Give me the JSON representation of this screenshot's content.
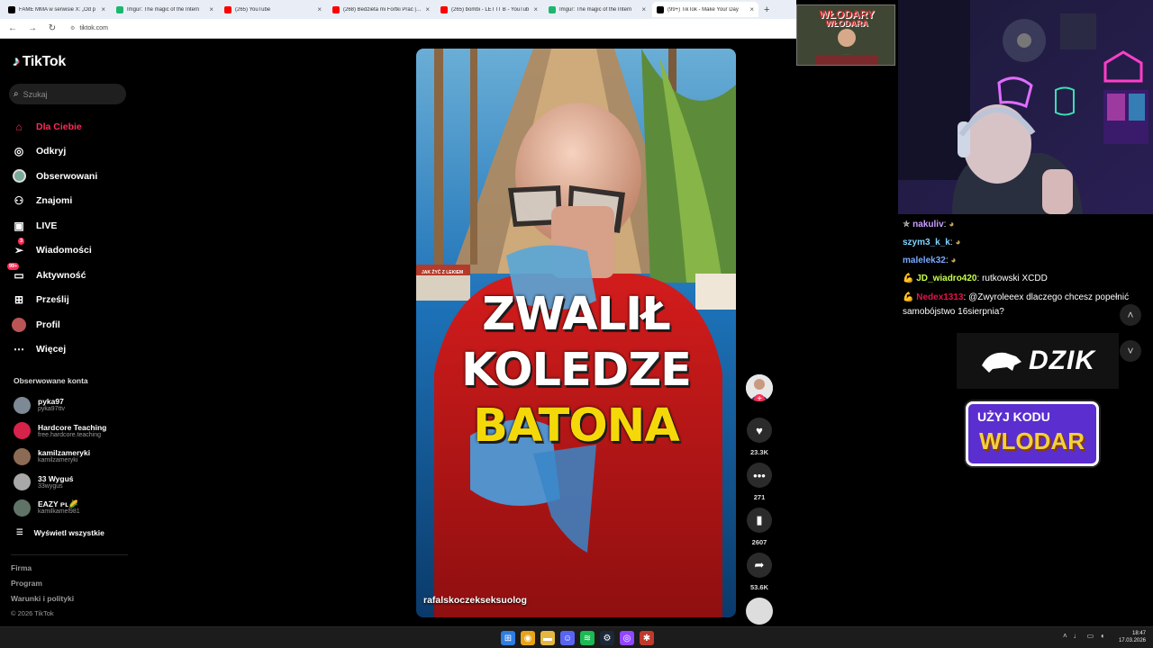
{
  "browser": {
    "tabs": [
      {
        "title": "FAME MMA w serwisie X: „Od p",
        "icon_color": "#000000",
        "active": false
      },
      {
        "title": "Imgur: The magic of the Intern",
        "icon_color": "#1bb76e",
        "active": false
      },
      {
        "title": "(265) YouTube",
        "icon_color": "#ff0000",
        "active": false
      },
      {
        "title": "(268) Bedzieta mi Fortki Prać | Fl",
        "icon_color": "#ff0000",
        "active": false
      },
      {
        "title": "(265) bombi - LET IT B - YouTub",
        "icon_color": "#ff0000",
        "active": false
      },
      {
        "title": "Imgur: The magic of the Intern",
        "icon_color": "#1bb76e",
        "active": false
      },
      {
        "title": "(99+) TikTok - Make Your Day",
        "icon_color": "#000000",
        "active": true
      }
    ],
    "close_glyph": "×",
    "new_tab_glyph": "+",
    "url": "tiktok.com"
  },
  "sidebar": {
    "logo_text": "TikTok",
    "search_placeholder": "Szukaj",
    "nav": [
      {
        "label": "Dla Ciebie",
        "icon": "home-icon",
        "active": true
      },
      {
        "label": "Odkryj",
        "icon": "compass-icon"
      },
      {
        "label": "Obserwowani",
        "icon": "following-icon"
      },
      {
        "label": "Znajomi",
        "icon": "friends-icon"
      },
      {
        "label": "LIVE",
        "icon": "live-icon"
      },
      {
        "label": "Wiadomości",
        "icon": "messages-icon",
        "badge": "3"
      },
      {
        "label": "Aktywność",
        "icon": "activity-icon",
        "badge": "99+"
      },
      {
        "label": "Prześlij",
        "icon": "upload-icon"
      },
      {
        "label": "Profil",
        "icon": "profile-icon"
      },
      {
        "label": "Więcej",
        "icon": "more-icon"
      }
    ],
    "following_title": "Obserwowane konta",
    "following": [
      {
        "name": "pyka97",
        "handle": "pyka97ttv",
        "color": "#7d8a96"
      },
      {
        "name": "Hardcore Teaching",
        "handle": "free.hardcore.teaching",
        "color": "#d6234a"
      },
      {
        "name": "kamilzameryki",
        "handle": "kamilzameryki",
        "color": "#8c6b55"
      },
      {
        "name": "33 Wyguś",
        "handle": "33wygus",
        "color": "#a8a8a8"
      },
      {
        "name": "EAZY ᴘʟ🌽",
        "handle": "kamilkamel981",
        "color": "#5f7466"
      }
    ],
    "show_all": "Wyświetl wszystkie",
    "footer": [
      "Firma",
      "Program",
      "Warunki i polityki"
    ],
    "copyright": "© 2026 TikTok"
  },
  "video": {
    "overlay_line1": "ZWALIŁ",
    "overlay_line2": "KOLEDZE",
    "overlay_line3": "BATONA",
    "author": "rafalskoczekseksuolog",
    "book_text": "JAK ŻYĆ Z LEKIEM"
  },
  "actions": {
    "likes": "23.3K",
    "comments": "271",
    "saves": "2607",
    "shares": "53.6K"
  },
  "stream": {
    "logo_line1": "WŁODARY",
    "logo_line2": "WŁODARA",
    "chat": [
      {
        "user": "nakuliv",
        "text": "",
        "color": "#c9a0ff",
        "prefix": "✯ "
      },
      {
        "user": "szym3_k_k",
        "text": "",
        "color": "#7fd4ff",
        "prefix": ""
      },
      {
        "user": "malelek32",
        "text": "",
        "color": "#79a9ff",
        "prefix": ""
      },
      {
        "user": "JD_wiadro420",
        "text": "rutkowski XCDD",
        "color": "#c8ff4a",
        "prefix": "💪 "
      },
      {
        "user": "Nedex1313",
        "text": "@Zwyroleeex dlaczego chcesz popełnić samobójstwo 16sierpnia?",
        "color": "#e0144c",
        "prefix": "💪 "
      }
    ],
    "sponsor": "DZIK",
    "promo_line1": "UŻYJ KODU",
    "promo_line2": "WLODAR"
  },
  "taskbar": {
    "time": "18:47",
    "date": "17.03.2026"
  }
}
